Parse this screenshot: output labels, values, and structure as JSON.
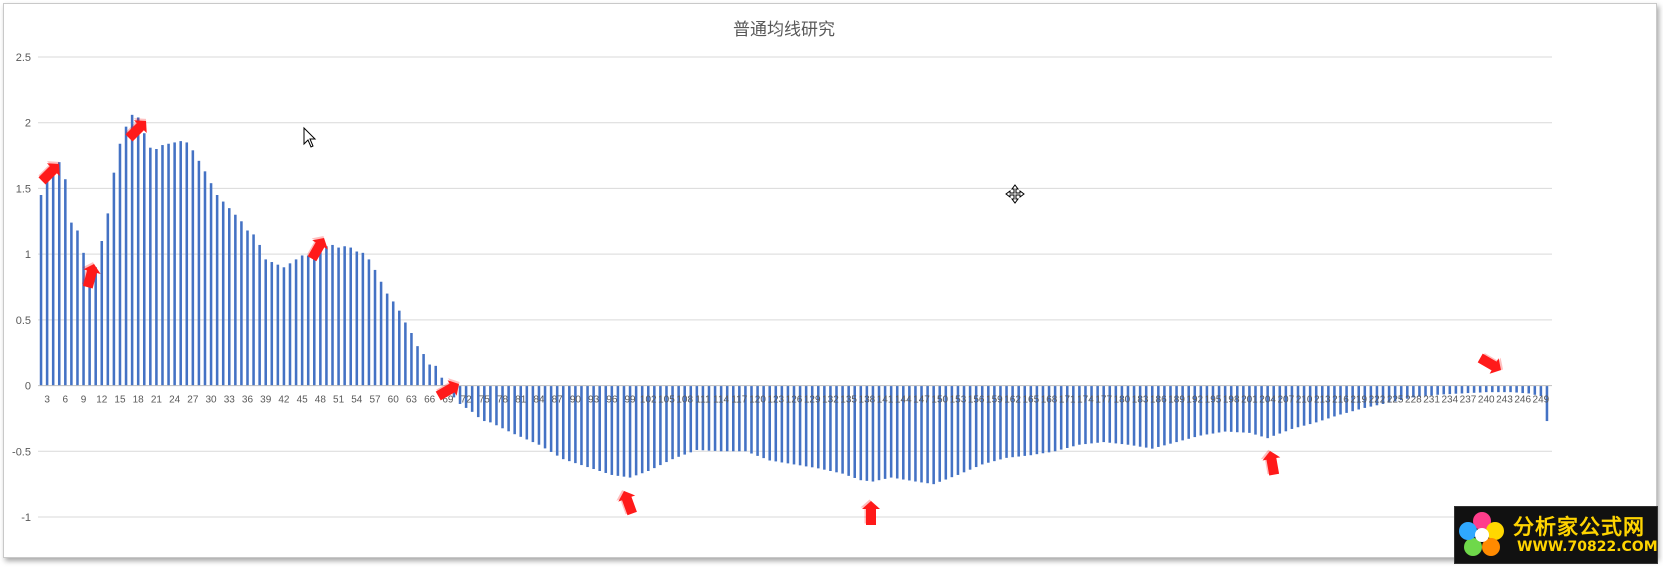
{
  "chart_data": {
    "type": "bar",
    "title": "普通均线研究",
    "xlabel": "",
    "ylabel": "",
    "ylim": [
      -1,
      2.5
    ],
    "yticks": [
      "2.5",
      "2",
      "1.5",
      "1",
      "0.5",
      "0",
      "-0.5",
      "-1"
    ],
    "x_start": 2,
    "x_end": 250,
    "x_label_step": 3,
    "grid": true,
    "series_color": "#4472c4",
    "keyframes": [
      [
        2,
        1.45
      ],
      [
        3,
        1.58
      ],
      [
        4,
        1.66
      ],
      [
        5,
        1.7
      ],
      [
        6,
        1.57
      ],
      [
        7,
        1.24
      ],
      [
        8,
        1.18
      ],
      [
        9,
        1.01
      ],
      [
        10,
        0.88
      ],
      [
        11,
        0.9
      ],
      [
        12,
        1.1
      ],
      [
        13,
        1.31
      ],
      [
        14,
        1.62
      ],
      [
        15,
        1.84
      ],
      [
        16,
        1.97
      ],
      [
        17,
        2.06
      ],
      [
        18,
        2.04
      ],
      [
        19,
        1.92
      ],
      [
        20,
        1.81
      ],
      [
        21,
        1.8
      ],
      [
        22,
        1.83
      ],
      [
        23,
        1.84
      ],
      [
        24,
        1.85
      ],
      [
        25,
        1.86
      ],
      [
        26,
        1.85
      ],
      [
        27,
        1.79
      ],
      [
        28,
        1.71
      ],
      [
        29,
        1.63
      ],
      [
        30,
        1.54
      ],
      [
        31,
        1.45
      ],
      [
        32,
        1.4
      ],
      [
        33,
        1.35
      ],
      [
        34,
        1.3
      ],
      [
        35,
        1.25
      ],
      [
        36,
        1.18
      ],
      [
        37,
        1.15
      ],
      [
        38,
        1.07
      ],
      [
        39,
        0.96
      ],
      [
        40,
        0.94
      ],
      [
        41,
        0.92
      ],
      [
        42,
        0.9
      ],
      [
        43,
        0.93
      ],
      [
        44,
        0.96
      ],
      [
        45,
        0.99
      ],
      [
        46,
        0.99
      ],
      [
        47,
        1.02
      ],
      [
        48,
        1.03
      ],
      [
        49,
        1.06
      ],
      [
        50,
        1.07
      ],
      [
        51,
        1.05
      ],
      [
        52,
        1.06
      ],
      [
        53,
        1.05
      ],
      [
        54,
        1.02
      ],
      [
        55,
        1.01
      ],
      [
        56,
        0.96
      ],
      [
        57,
        0.88
      ],
      [
        58,
        0.79
      ],
      [
        59,
        0.7
      ],
      [
        60,
        0.64
      ],
      [
        61,
        0.57
      ],
      [
        62,
        0.48
      ],
      [
        63,
        0.4
      ],
      [
        64,
        0.3
      ],
      [
        65,
        0.24
      ],
      [
        66,
        0.16
      ],
      [
        67,
        0.15
      ],
      [
        68,
        0.06
      ],
      [
        69,
        -0.02
      ],
      [
        70,
        -0.09
      ],
      [
        71,
        -0.14
      ],
      [
        72,
        -0.17
      ],
      [
        73,
        -0.2
      ],
      [
        74,
        -0.24
      ],
      [
        75,
        -0.27
      ],
      [
        76,
        -0.28
      ],
      [
        80,
        -0.37
      ],
      [
        84,
        -0.45
      ],
      [
        88,
        -0.56
      ],
      [
        92,
        -0.62
      ],
      [
        96,
        -0.68
      ],
      [
        99,
        -0.7
      ],
      [
        102,
        -0.65
      ],
      [
        106,
        -0.56
      ],
      [
        110,
        -0.49
      ],
      [
        114,
        -0.5
      ],
      [
        118,
        -0.5
      ],
      [
        122,
        -0.57
      ],
      [
        126,
        -0.6
      ],
      [
        130,
        -0.63
      ],
      [
        134,
        -0.67
      ],
      [
        137,
        -0.72
      ],
      [
        139,
        -0.73
      ],
      [
        142,
        -0.7
      ],
      [
        146,
        -0.73
      ],
      [
        149,
        -0.75
      ],
      [
        153,
        -0.68
      ],
      [
        157,
        -0.6
      ],
      [
        161,
        -0.55
      ],
      [
        165,
        -0.53
      ],
      [
        169,
        -0.5
      ],
      [
        173,
        -0.45
      ],
      [
        177,
        -0.43
      ],
      [
        181,
        -0.45
      ],
      [
        185,
        -0.48
      ],
      [
        189,
        -0.43
      ],
      [
        193,
        -0.38
      ],
      [
        197,
        -0.35
      ],
      [
        201,
        -0.36
      ],
      [
        204,
        -0.4
      ],
      [
        208,
        -0.33
      ],
      [
        212,
        -0.28
      ],
      [
        216,
        -0.22
      ],
      [
        220,
        -0.17
      ],
      [
        224,
        -0.13
      ],
      [
        228,
        -0.09
      ],
      [
        232,
        -0.07
      ],
      [
        236,
        -0.06
      ],
      [
        240,
        -0.05
      ],
      [
        244,
        -0.05
      ],
      [
        247,
        -0.06
      ],
      [
        248,
        -0.07
      ],
      [
        249,
        -0.08
      ],
      [
        250,
        -0.27
      ]
    ]
  },
  "watermark": {
    "text": "分析家公式网",
    "url": "WWW.70822.COM"
  }
}
